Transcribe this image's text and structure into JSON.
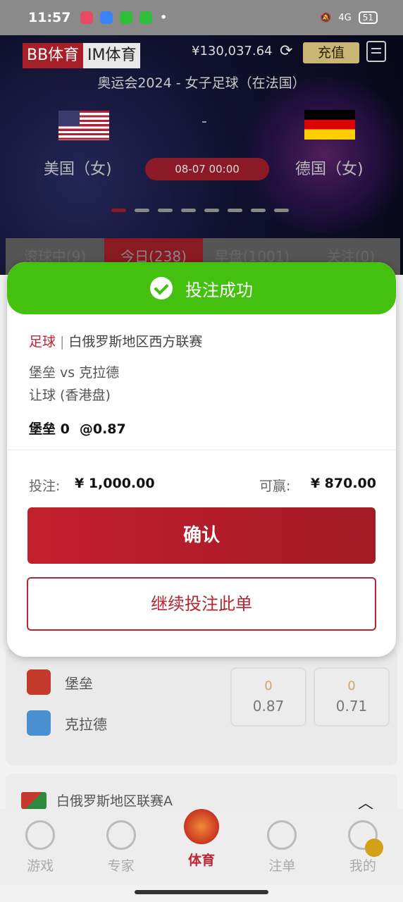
{
  "status_bar": {
    "time": "11:57",
    "signal": "4G",
    "battery": "51"
  },
  "header": {
    "logo_bb": "BB体育",
    "logo_im": "IM体育",
    "balance": "¥130,037.64",
    "recharge_label": "充值"
  },
  "hero": {
    "event_title": "奥运会2024 - 女子足球（在法国）",
    "home_team": "美国（女)",
    "away_team": "德国（女)",
    "vs": "-",
    "match_time": "08-07  00:00",
    "carousel_active_index": 0,
    "carousel_count": 8
  },
  "tabs": [
    {
      "label": "滚球中(9)"
    },
    {
      "label": "今日(238)"
    },
    {
      "label": "早盘(1001)"
    },
    {
      "label": "关注(0)"
    }
  ],
  "modal": {
    "title": "投注成功",
    "sport": "足球",
    "league": "白俄罗斯地区西方联赛",
    "matchup": "堡垒 vs 克拉德",
    "market": "让球 (香港盘)",
    "selection": "堡垒 0",
    "odds": "@0.87",
    "stake_label": "投注:",
    "stake_value": "¥ 1,000.00",
    "win_label": "可赢:",
    "win_value": "¥ 870.00",
    "confirm_label": "确认",
    "continue_label": "继续投注此单"
  },
  "match_card": {
    "home": "堡垒",
    "away": "克拉德",
    "odds": [
      {
        "handicap": "0",
        "price": "0.87"
      },
      {
        "handicap": "0",
        "price": "0.71"
      }
    ]
  },
  "league2": {
    "name": "白俄罗斯地区联赛A"
  },
  "bottom_nav": [
    {
      "label": "游戏",
      "icon": "game-icon"
    },
    {
      "label": "专家",
      "icon": "expert-icon"
    },
    {
      "label": "体育",
      "icon": "trophy-icon"
    },
    {
      "label": "注单",
      "icon": "list-icon"
    },
    {
      "label": "我的",
      "icon": "profile-icon"
    }
  ],
  "colors": {
    "brand_red": "#c0242f",
    "success_green": "#44c10f",
    "gold": "#c9b675"
  }
}
